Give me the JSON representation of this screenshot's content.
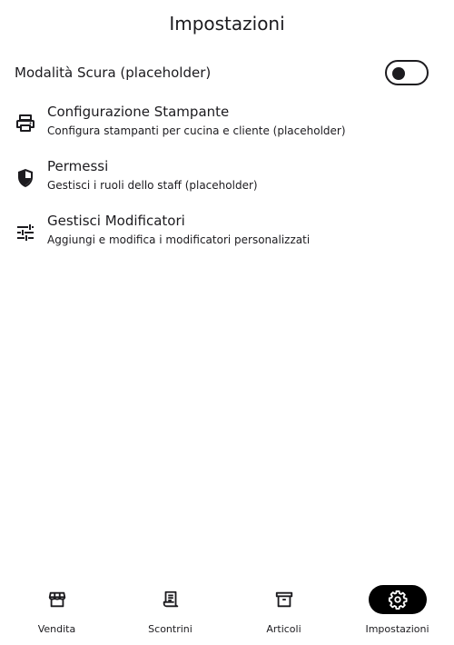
{
  "header": {
    "title": "Impostazioni"
  },
  "dark_mode": {
    "label": "Modalità Scura (placeholder)",
    "enabled": false
  },
  "settings_items": [
    {
      "icon": "printer-icon",
      "title": "Configurazione Stampante",
      "subtitle": "Configura stampanti per cucina e cliente (placeholder)"
    },
    {
      "icon": "shield-icon",
      "title": "Permessi",
      "subtitle": "Gestisci i ruoli dello staff (placeholder)"
    },
    {
      "icon": "tune-icon",
      "title": "Gestisci Modificatori",
      "subtitle": "Aggiungi e modifica i modificatori personalizzati"
    }
  ],
  "nav": {
    "items": [
      {
        "label": "Vendita",
        "icon": "store-icon",
        "active": false
      },
      {
        "label": "Scontrini",
        "icon": "receipt-icon",
        "active": false
      },
      {
        "label": "Articoli",
        "icon": "archive-icon",
        "active": false
      },
      {
        "label": "Impostazioni",
        "icon": "gear-icon",
        "active": true
      }
    ]
  },
  "colors": {
    "text": "#1c1b1f",
    "active_pill": "#000000",
    "active_icon": "#ffffff",
    "background": "#ffffff"
  }
}
